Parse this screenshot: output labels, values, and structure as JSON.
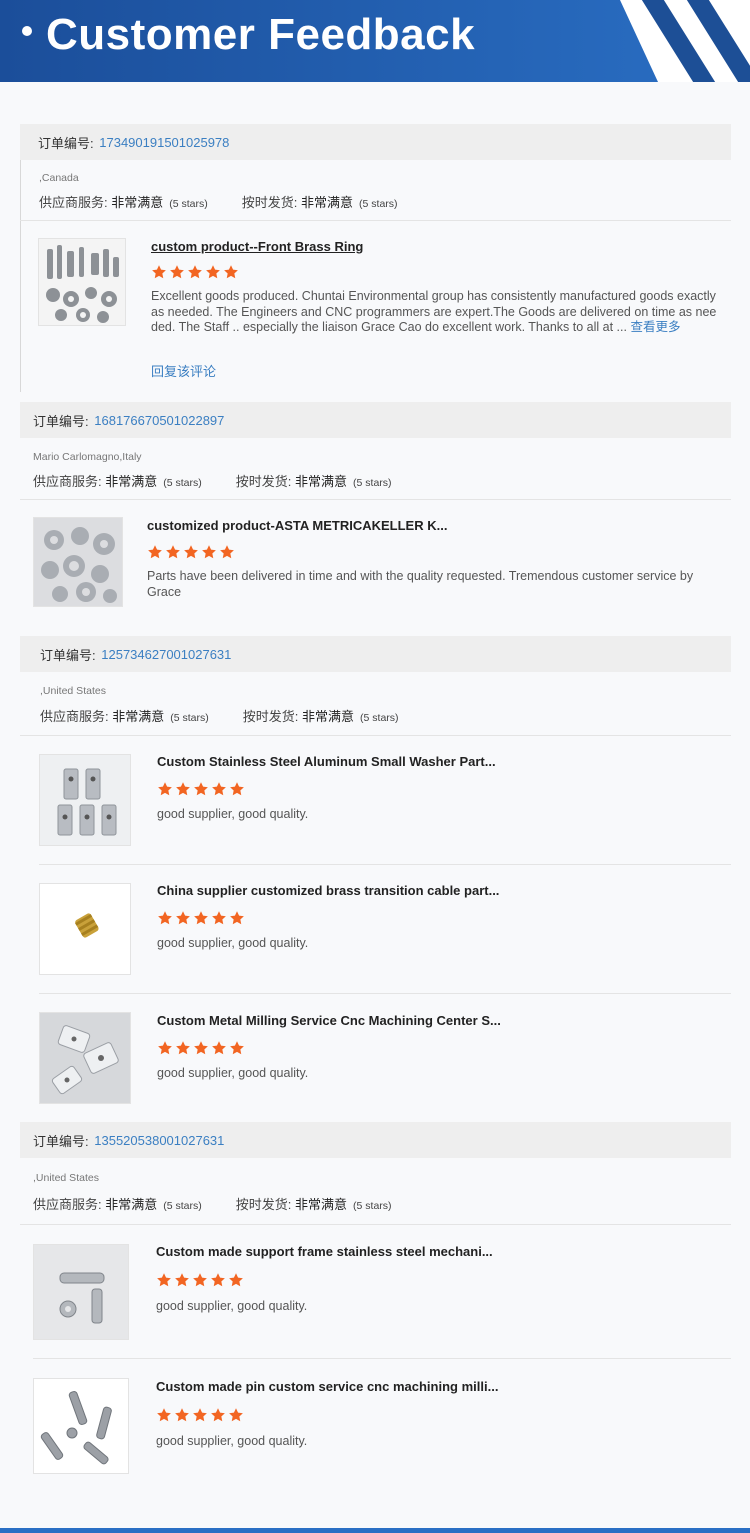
{
  "header": {
    "title": "Customer Feedback"
  },
  "labels": {
    "order_no": "订单编号:",
    "supplier_service": "供应商服务:",
    "on_time": "按时发货:",
    "very_satisfied": "非常满意",
    "five_stars": "(5 stars)",
    "see_more": "查看更多",
    "reply": "回复该评论"
  },
  "colors": {
    "accent": "#2a6fc4",
    "star": "#f26522",
    "link": "#3b7fc2"
  },
  "orders": [
    {
      "number": "173490191501025978",
      "location": ",Canada",
      "products": [
        {
          "title": "custom product--Front Brass Ring",
          "stars": 5,
          "review": "Excellent goods produced. Chuntai Environmental group has consistently manufactured goods exactly as needed. The Engineers and CNC programmers are expert.The Goods are delivered on time as needed. The Staff .. especially the liaison Grace Cao do excellent work.  Thanks to all at ..."
        }
      ]
    },
    {
      "number": "168176670501022897",
      "location": "Mario Carlomagno,Italy",
      "products": [
        {
          "title": "customized product-ASTA METRICAKELLER K...",
          "stars": 5,
          "review": "Parts have been delivered in time and with the quality requested. Tremendous customer service by Grace"
        }
      ]
    },
    {
      "number": "125734627001027631",
      "location": ",United States",
      "products": [
        {
          "title": "Custom Stainless Steel Aluminum Small Washer Part...",
          "stars": 5,
          "review": "good supplier, good quality."
        },
        {
          "title": "China supplier customized brass transition cable part...",
          "stars": 5,
          "review": "good supplier, good quality."
        },
        {
          "title": "Custom Metal Milling Service Cnc Machining Center S...",
          "stars": 5,
          "review": "good supplier, good quality."
        }
      ]
    },
    {
      "number": "135520538001027631",
      "location": ",United States",
      "products": [
        {
          "title": "Custom made support frame stainless steel mechani...",
          "stars": 5,
          "review": "good supplier, good quality."
        },
        {
          "title": "Custom made pin custom service cnc machining milli...",
          "stars": 5,
          "review": "good supplier, good quality."
        }
      ]
    }
  ]
}
